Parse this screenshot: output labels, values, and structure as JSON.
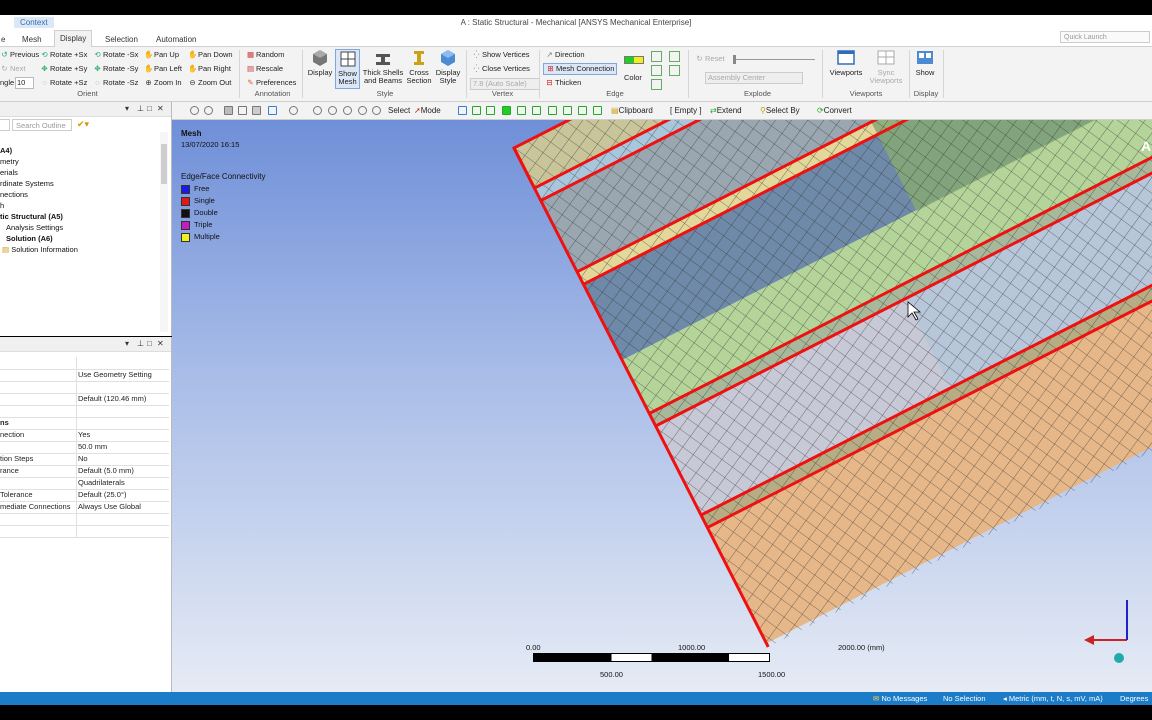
{
  "window": {
    "context_tab": "Context",
    "title": "A : Static Structural - Mechanical [ANSYS Mechanical Enterprise]"
  },
  "ribbon_tabs": [
    "e",
    "Mesh",
    "Display",
    "Selection",
    "Automation"
  ],
  "active_tab": "Display",
  "quick_launch_placeholder": "Quick Launch",
  "orient": {
    "items": [
      "Previous",
      "Next",
      "ngle",
      "10",
      "Rotate +Sx",
      "Rotate +Sy",
      "Rotate +Sz",
      "Rotate -Sx",
      "Rotate -Sy",
      "Rotate -Sz",
      "Pan Up",
      "Pan Left",
      "Zoom In",
      "Pan Down",
      "Pan Right",
      "Zoom Out"
    ],
    "group_label": "Orient"
  },
  "annotation": {
    "items": [
      "Random",
      "Rescale",
      "Preferences"
    ],
    "group_label": "Annotation"
  },
  "style": {
    "display": "Display",
    "show_mesh": [
      "Show",
      "Mesh"
    ],
    "thick_shells": [
      "Thick Shells",
      "and Beams"
    ],
    "cross_section": [
      "Cross",
      "Section"
    ],
    "display_style": [
      "Display",
      "Style"
    ],
    "group_label": "Style"
  },
  "vertex": {
    "show_vertices": "Show Vertices",
    "close_vertices": "Close Vertices",
    "auto_scale": "7.8 (Auto Scale)",
    "group_label": "Vertex"
  },
  "edge": {
    "direction": "Direction",
    "mesh_connection": "Mesh Connection",
    "thicken": "Thicken",
    "color": "Color",
    "group_label": "Edge"
  },
  "explode": {
    "reset": "Reset",
    "assembly_center": "Assembly Center",
    "group_label": "Explode"
  },
  "viewports": {
    "viewports": "Viewports",
    "sync": [
      "Sync",
      "Viewports"
    ],
    "group_label": "Viewports"
  },
  "display_group": {
    "show": "Show",
    "group_label": "Display"
  },
  "toolbar": {
    "select": "Select",
    "mode": "Mode",
    "clipboard": "Clipboard",
    "empty": "[ Empty ]",
    "extend": "Extend",
    "select_by": "Select By",
    "convert": "Convert"
  },
  "outline": {
    "search_placeholder": "Search Outline",
    "items": [
      {
        "label": "A4)",
        "bold": true
      },
      {
        "label": "metry",
        "bold": false
      },
      {
        "label": "erials",
        "bold": false
      },
      {
        "label": "rdinate Systems",
        "bold": false
      },
      {
        "label": "nections",
        "bold": false
      },
      {
        "label": "h",
        "bold": false
      },
      {
        "label": "tic Structural (A5)",
        "bold": true
      },
      {
        "label": "Analysis Settings",
        "bold": false
      },
      {
        "label": "Solution (A6)",
        "bold": true
      },
      {
        "label": "Solution Information",
        "bold": false
      }
    ]
  },
  "details": {
    "rows": [
      {
        "k": "",
        "v": ""
      },
      {
        "k": "",
        "v": "Use Geometry Setting"
      },
      {
        "k": "",
        "v": ""
      },
      {
        "k": "",
        "v": "Default (120.46 mm)"
      },
      {
        "k": "",
        "v": ""
      },
      {
        "k": "ns",
        "v": "",
        "bold": true
      },
      {
        "k": "nection",
        "v": "Yes"
      },
      {
        "k": "",
        "v": "50.0 mm"
      },
      {
        "k": "tion Steps",
        "v": "No"
      },
      {
        "k": "rance",
        "v": "Default (5.0 mm)"
      },
      {
        "k": "",
        "v": "Quadrilaterals"
      },
      {
        "k": "Tolerance",
        "v": "Default (25.0°)"
      },
      {
        "k": "mediate Connections",
        "v": "Always Use Global"
      },
      {
        "k": "",
        "v": ""
      },
      {
        "k": "",
        "v": ""
      }
    ]
  },
  "viewport": {
    "title": "Mesh",
    "date": "13/07/2020 16:15",
    "legend_title": "Edge/Face Connectivity",
    "legend": [
      {
        "label": "Free",
        "color": "#1a1ae6"
      },
      {
        "label": "Single",
        "color": "#e01818"
      },
      {
        "label": "Double",
        "color": "#111111"
      },
      {
        "label": "Triple",
        "color": "#c21fc2"
      },
      {
        "label": "Multiple",
        "color": "#f0f020"
      }
    ],
    "scale": {
      "t0": "0.00",
      "t1": "1000.00",
      "t2": "2000.00 (mm)",
      "b1": "500.00",
      "b2": "1500.00"
    },
    "corner_label": "A"
  },
  "status": {
    "messages": "No Messages",
    "selection": "No Selection",
    "units": "Metric (mm, t, N, s, mV, mA)",
    "angle": "Degrees"
  }
}
